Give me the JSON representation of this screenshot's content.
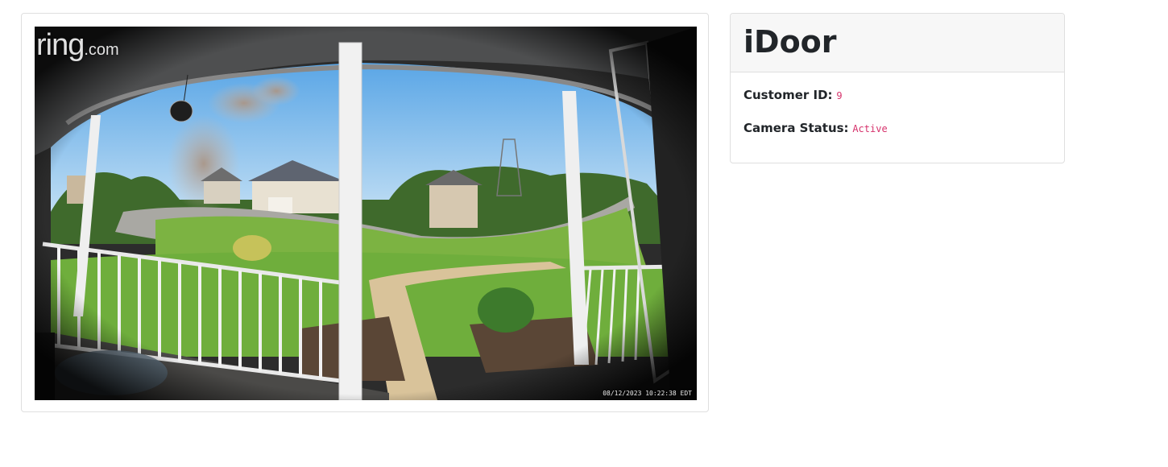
{
  "camera": {
    "logo_main": "ring",
    "logo_tld": ".com",
    "timestamp": "08/12/2023 10:22:38 EDT"
  },
  "info": {
    "title": "iDoor",
    "customer_id_label": "Customer ID:",
    "customer_id_value": "9",
    "camera_status_label": "Camera Status:",
    "camera_status_value": "Active"
  },
  "colors": {
    "value_accent": "#d6336c",
    "sky": "#8ec6ee",
    "lawn": "#6fae3c"
  }
}
